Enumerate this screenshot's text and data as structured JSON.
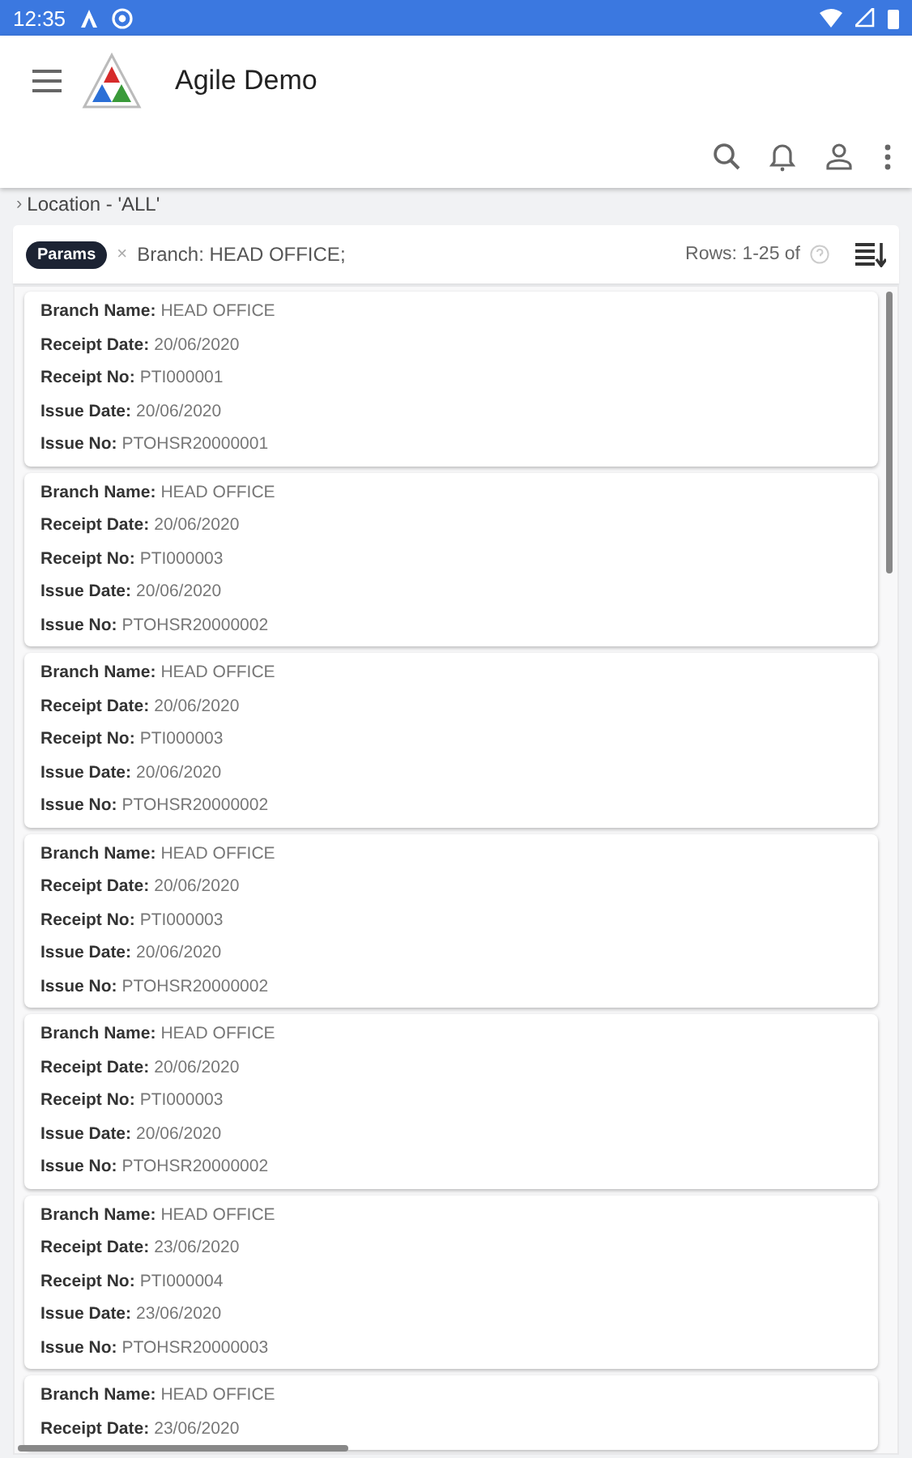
{
  "status_bar": {
    "time": "12:35"
  },
  "app_bar": {
    "title": "Agile Demo"
  },
  "breadcrumb": {
    "chevron": "›",
    "label": "Location - 'ALL'"
  },
  "filter": {
    "chip": "Params",
    "remove": "×",
    "text": "Branch: HEAD OFFICE;",
    "rows": "Rows: 1-25 of"
  },
  "records": [
    {
      "fields": [
        {
          "label": "Branch Name:",
          "value": "HEAD OFFICE"
        },
        {
          "label": "Receipt Date:",
          "value": "20/06/2020"
        },
        {
          "label": "Receipt No:",
          "value": "PTI000001"
        },
        {
          "label": "Issue Date:",
          "value": "20/06/2020"
        },
        {
          "label": "Issue No:",
          "value": "PTOHSR20000001"
        }
      ]
    },
    {
      "fields": [
        {
          "label": "Branch Name:",
          "value": "HEAD OFFICE"
        },
        {
          "label": "Receipt Date:",
          "value": "20/06/2020"
        },
        {
          "label": "Receipt No:",
          "value": "PTI000003"
        },
        {
          "label": "Issue Date:",
          "value": "20/06/2020"
        },
        {
          "label": "Issue No:",
          "value": "PTOHSR20000002"
        }
      ]
    },
    {
      "fields": [
        {
          "label": "Branch Name:",
          "value": "HEAD OFFICE"
        },
        {
          "label": "Receipt Date:",
          "value": "20/06/2020"
        },
        {
          "label": "Receipt No:",
          "value": "PTI000003"
        },
        {
          "label": "Issue Date:",
          "value": "20/06/2020"
        },
        {
          "label": "Issue No:",
          "value": "PTOHSR20000002"
        }
      ]
    },
    {
      "fields": [
        {
          "label": "Branch Name:",
          "value": "HEAD OFFICE"
        },
        {
          "label": "Receipt Date:",
          "value": "20/06/2020"
        },
        {
          "label": "Receipt No:",
          "value": "PTI000003"
        },
        {
          "label": "Issue Date:",
          "value": "20/06/2020"
        },
        {
          "label": "Issue No:",
          "value": "PTOHSR20000002"
        }
      ]
    },
    {
      "fields": [
        {
          "label": "Branch Name:",
          "value": "HEAD OFFICE"
        },
        {
          "label": "Receipt Date:",
          "value": "20/06/2020"
        },
        {
          "label": "Receipt No:",
          "value": "PTI000003"
        },
        {
          "label": "Issue Date:",
          "value": "20/06/2020"
        },
        {
          "label": "Issue No:",
          "value": "PTOHSR20000002"
        }
      ]
    },
    {
      "fields": [
        {
          "label": "Branch Name:",
          "value": "HEAD OFFICE"
        },
        {
          "label": "Receipt Date:",
          "value": "23/06/2020"
        },
        {
          "label": "Receipt No:",
          "value": "PTI000004"
        },
        {
          "label": "Issue Date:",
          "value": "23/06/2020"
        },
        {
          "label": "Issue No:",
          "value": "PTOHSR20000003"
        }
      ]
    },
    {
      "fields": [
        {
          "label": "Branch Name:",
          "value": "HEAD OFFICE"
        },
        {
          "label": "Receipt Date:",
          "value": "23/06/2020"
        }
      ]
    }
  ]
}
